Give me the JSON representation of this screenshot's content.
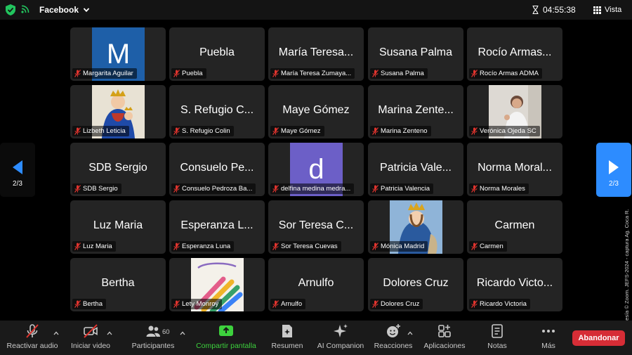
{
  "topbar": {
    "app_label": "Facebook",
    "timer": "04:55:38",
    "view_label": "Vista",
    "icons": [
      "shield-check-icon",
      "signal-icon",
      "chevron-down-icon",
      "hourglass-icon",
      "grid-icon"
    ]
  },
  "nav": {
    "left_page": "2/3",
    "right_page": "2/3",
    "accent": "#2d8cff"
  },
  "tiles": {
    "t0": {
      "caption": "Margarita Aguilar",
      "initial": "M"
    },
    "t1": {
      "name": "Puebla",
      "caption": "Puebla"
    },
    "t2": {
      "name": "María Teresa...",
      "caption": "María Teresa Zumaya..."
    },
    "t3": {
      "name": "Susana Palma",
      "caption": "Susana Palma"
    },
    "t4": {
      "name": "Rocío Armas...",
      "caption": "Rocío Armas ADMA"
    },
    "t5": {
      "caption": "Lizbeth Leticia"
    },
    "t6": {
      "name": "S. Refugio C...",
      "caption": "S. Refugio Colin"
    },
    "t7": {
      "name": "Maye Gómez",
      "caption": "Maye Gómez"
    },
    "t8": {
      "name": "Marina Zente...",
      "caption": "Marina Zenteno"
    },
    "t9": {
      "caption": "Verónica Ojeda SC"
    },
    "t10": {
      "name": "SDB Sergio",
      "caption": "SDB Sergio"
    },
    "t11": {
      "name": "Consuelo Pe...",
      "caption": "Consuelo Pedroza Ba..."
    },
    "t12": {
      "caption": "delfina medina medra...",
      "initial": "d"
    },
    "t13": {
      "name": "Patricia Vale...",
      "caption": "Patricia Valencia"
    },
    "t14": {
      "name": "Norma Moral...",
      "caption": "Norma Morales"
    },
    "t15": {
      "name": "Luz Maria",
      "caption": "Luz Maria"
    },
    "t16": {
      "name": "Esperanza L...",
      "caption": "Esperanza Luna"
    },
    "t17": {
      "name": "Sor Teresa C...",
      "caption": "Sor Teresa Cuevas"
    },
    "t18": {
      "caption": "Mónica Madrid"
    },
    "t19": {
      "name": "Carmen",
      "caption": "Carmen"
    },
    "t20": {
      "name": "Bertha",
      "caption": "Bertha"
    },
    "t21": {
      "caption": "Lety Monroy"
    },
    "t22": {
      "name": "Arnulfo",
      "caption": "Arnulfo"
    },
    "t23": {
      "name": "Dolores Cruz",
      "caption": "Dolores Cruz"
    },
    "t24": {
      "name": "Ricardo Victo...",
      "caption": "Ricardo Victoria"
    }
  },
  "toolbar": {
    "audio_label": "Reactivar audio",
    "video_label": "Iniciar video",
    "participants_label": "Participantes",
    "participants_count": "60",
    "share_label": "Compartir pantalla",
    "summary_label": "Resumen",
    "companion_label": "AI Companion",
    "reactions_label": "Reacciones",
    "apps_label": "Aplicaciones",
    "notes_label": "Notas",
    "more_label": "Más",
    "leave_label": "Abandonar",
    "share_color": "#3dd13d",
    "leave_color": "#d62d36"
  },
  "watermark": "Cortesía © Zoom. JEFS-2024 - captura Ag. Coca R."
}
